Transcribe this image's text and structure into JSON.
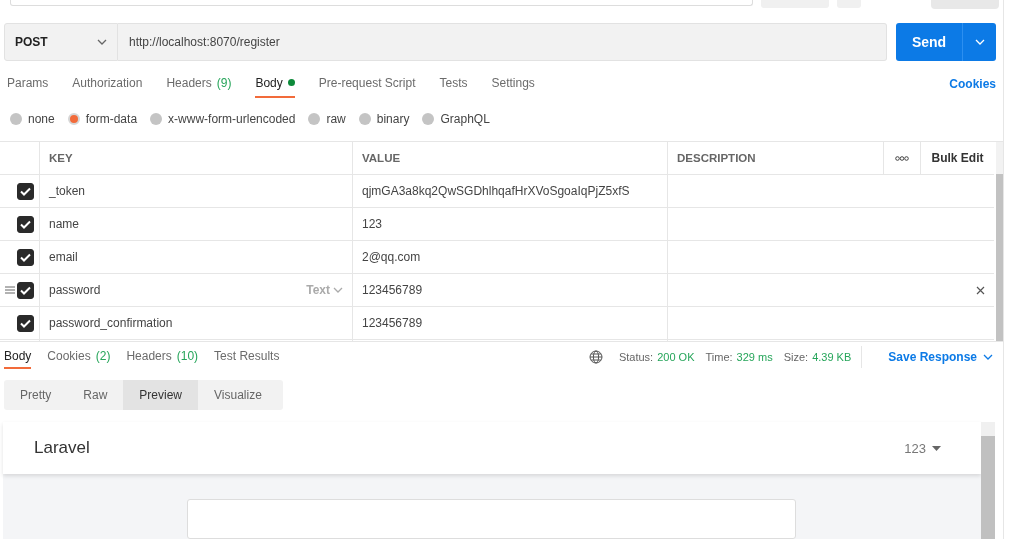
{
  "request": {
    "method": "POST",
    "url": "http://localhost:8070/register",
    "send": "Send"
  },
  "request_tabs": [
    {
      "label": "Params",
      "selected": false,
      "dot": false
    },
    {
      "label": "Authorization",
      "selected": false,
      "dot": false
    },
    {
      "label": "Headers",
      "count": "(9)",
      "selected": false,
      "dot": false
    },
    {
      "label": "Body",
      "selected": true,
      "dot": true
    },
    {
      "label": "Pre-request Script",
      "selected": false,
      "dot": false
    },
    {
      "label": "Tests",
      "selected": false,
      "dot": false
    },
    {
      "label": "Settings",
      "selected": false,
      "dot": false
    }
  ],
  "cookies_link": "Cookies",
  "body_types": [
    {
      "label": "none",
      "selected": false
    },
    {
      "label": "form-data",
      "selected": true
    },
    {
      "label": "x-www-form-urlencoded",
      "selected": false
    },
    {
      "label": "raw",
      "selected": false
    },
    {
      "label": "binary",
      "selected": false
    },
    {
      "label": "GraphQL",
      "selected": false
    }
  ],
  "params_table": {
    "columns": [
      "KEY",
      "VALUE",
      "DESCRIPTION"
    ],
    "bulk_edit": "Bulk Edit",
    "rows": [
      {
        "checked": true,
        "key": "_token",
        "value": "qjmGA3a8kq2QwSGDhlhqafHrXVoSgoaIqPjZ5xfS",
        "hovered": false
      },
      {
        "checked": true,
        "key": "name",
        "value": "123",
        "hovered": false
      },
      {
        "checked": true,
        "key": "email",
        "value": "2@qq.com",
        "hovered": false
      },
      {
        "checked": true,
        "key": "password",
        "value": "123456789",
        "hovered": true,
        "type_label": "Text"
      },
      {
        "checked": true,
        "key": "password_confirmation",
        "value": "123456789",
        "hovered": false
      }
    ]
  },
  "response": {
    "tabs": [
      {
        "label": "Body",
        "selected": true
      },
      {
        "label": "Cookies",
        "count": "(2)",
        "selected": false
      },
      {
        "label": "Headers",
        "count": "(10)",
        "selected": false
      },
      {
        "label": "Test Results",
        "selected": false
      }
    ],
    "stats": [
      {
        "label": "Status:",
        "value": "200 OK"
      },
      {
        "label": "Time:",
        "value": "329 ms"
      },
      {
        "label": "Size:",
        "value": "4.39 KB"
      }
    ],
    "save_response": "Save Response",
    "view_modes": [
      {
        "label": "Pretty",
        "selected": false
      },
      {
        "label": "Raw",
        "selected": false
      },
      {
        "label": "Preview",
        "selected": true
      },
      {
        "label": "Visualize",
        "selected": false
      }
    ],
    "preview": {
      "title": "Laravel",
      "user_menu": "123"
    }
  }
}
